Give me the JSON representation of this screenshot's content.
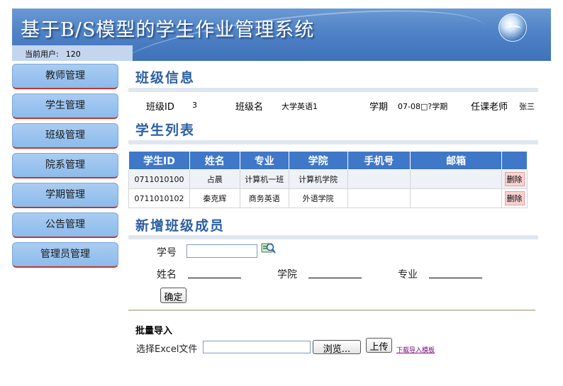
{
  "header": {
    "title": "基于B/S模型的学生作业管理系统",
    "current_user_label": "当前用户:",
    "current_user_value": "120"
  },
  "sidebar": {
    "items": [
      {
        "label": "教师管理"
      },
      {
        "label": "学生管理"
      },
      {
        "label": "班级管理"
      },
      {
        "label": "院系管理"
      },
      {
        "label": "学期管理"
      },
      {
        "label": "公告管理"
      },
      {
        "label": "管理员管理"
      }
    ]
  },
  "class_info": {
    "heading": "班级信息",
    "id_label": "班级ID",
    "id_value": "3",
    "name_label": "班级名",
    "name_value": "大学英语1",
    "term_label": "学期",
    "term_value": "07-08□?学期",
    "teacher_label": "任课老师",
    "teacher_value": "张三"
  },
  "student_list": {
    "heading": "学生列表",
    "columns": [
      "学生ID",
      "姓名",
      "专业",
      "学院",
      "手机号",
      "邮箱",
      ""
    ],
    "rows": [
      {
        "id": "0711010100",
        "name": "占晨",
        "major": "计算机一班",
        "college": "计算机学院",
        "phone": "",
        "email": "",
        "action": "删除"
      },
      {
        "id": "0711010102",
        "name": "秦克辉",
        "major": "商务英语",
        "college": "外语学院",
        "phone": "",
        "email": "",
        "action": "删除"
      }
    ]
  },
  "add_member": {
    "heading": "新增班级成员",
    "student_no_label": "学号",
    "student_no_value": "",
    "name_label": "姓名",
    "college_label": "学院",
    "major_label": "专业",
    "confirm_label": "确定"
  },
  "batch_import": {
    "heading": "批量导入",
    "file_label": "选择Excel文件",
    "file_value": "",
    "browse_label": "浏览...",
    "upload_label": "上传",
    "template_link": "下载导入模板"
  }
}
